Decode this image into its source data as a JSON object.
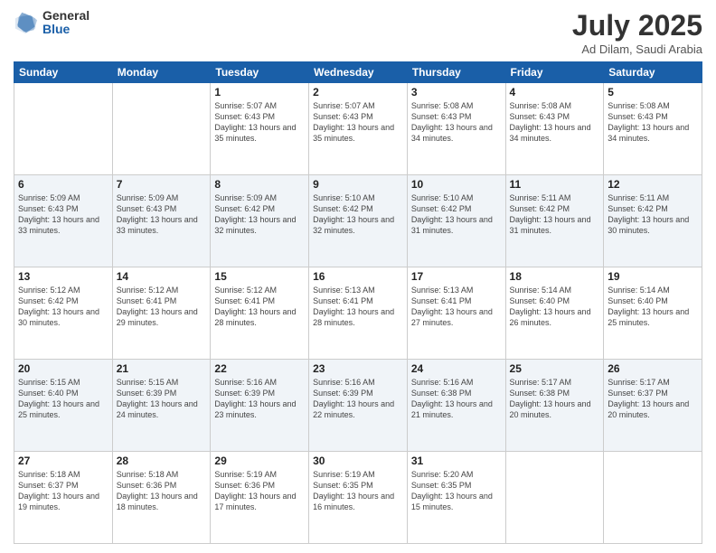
{
  "logo": {
    "general": "General",
    "blue": "Blue"
  },
  "header": {
    "title": "July 2025",
    "subtitle": "Ad Dilam, Saudi Arabia"
  },
  "weekdays": [
    "Sunday",
    "Monday",
    "Tuesday",
    "Wednesday",
    "Thursday",
    "Friday",
    "Saturday"
  ],
  "weeks": [
    [
      {
        "day": "",
        "info": ""
      },
      {
        "day": "",
        "info": ""
      },
      {
        "day": "1",
        "info": "Sunrise: 5:07 AM\nSunset: 6:43 PM\nDaylight: 13 hours and 35 minutes."
      },
      {
        "day": "2",
        "info": "Sunrise: 5:07 AM\nSunset: 6:43 PM\nDaylight: 13 hours and 35 minutes."
      },
      {
        "day": "3",
        "info": "Sunrise: 5:08 AM\nSunset: 6:43 PM\nDaylight: 13 hours and 34 minutes."
      },
      {
        "day": "4",
        "info": "Sunrise: 5:08 AM\nSunset: 6:43 PM\nDaylight: 13 hours and 34 minutes."
      },
      {
        "day": "5",
        "info": "Sunrise: 5:08 AM\nSunset: 6:43 PM\nDaylight: 13 hours and 34 minutes."
      }
    ],
    [
      {
        "day": "6",
        "info": "Sunrise: 5:09 AM\nSunset: 6:43 PM\nDaylight: 13 hours and 33 minutes."
      },
      {
        "day": "7",
        "info": "Sunrise: 5:09 AM\nSunset: 6:43 PM\nDaylight: 13 hours and 33 minutes."
      },
      {
        "day": "8",
        "info": "Sunrise: 5:09 AM\nSunset: 6:42 PM\nDaylight: 13 hours and 32 minutes."
      },
      {
        "day": "9",
        "info": "Sunrise: 5:10 AM\nSunset: 6:42 PM\nDaylight: 13 hours and 32 minutes."
      },
      {
        "day": "10",
        "info": "Sunrise: 5:10 AM\nSunset: 6:42 PM\nDaylight: 13 hours and 31 minutes."
      },
      {
        "day": "11",
        "info": "Sunrise: 5:11 AM\nSunset: 6:42 PM\nDaylight: 13 hours and 31 minutes."
      },
      {
        "day": "12",
        "info": "Sunrise: 5:11 AM\nSunset: 6:42 PM\nDaylight: 13 hours and 30 minutes."
      }
    ],
    [
      {
        "day": "13",
        "info": "Sunrise: 5:12 AM\nSunset: 6:42 PM\nDaylight: 13 hours and 30 minutes."
      },
      {
        "day": "14",
        "info": "Sunrise: 5:12 AM\nSunset: 6:41 PM\nDaylight: 13 hours and 29 minutes."
      },
      {
        "day": "15",
        "info": "Sunrise: 5:12 AM\nSunset: 6:41 PM\nDaylight: 13 hours and 28 minutes."
      },
      {
        "day": "16",
        "info": "Sunrise: 5:13 AM\nSunset: 6:41 PM\nDaylight: 13 hours and 28 minutes."
      },
      {
        "day": "17",
        "info": "Sunrise: 5:13 AM\nSunset: 6:41 PM\nDaylight: 13 hours and 27 minutes."
      },
      {
        "day": "18",
        "info": "Sunrise: 5:14 AM\nSunset: 6:40 PM\nDaylight: 13 hours and 26 minutes."
      },
      {
        "day": "19",
        "info": "Sunrise: 5:14 AM\nSunset: 6:40 PM\nDaylight: 13 hours and 25 minutes."
      }
    ],
    [
      {
        "day": "20",
        "info": "Sunrise: 5:15 AM\nSunset: 6:40 PM\nDaylight: 13 hours and 25 minutes."
      },
      {
        "day": "21",
        "info": "Sunrise: 5:15 AM\nSunset: 6:39 PM\nDaylight: 13 hours and 24 minutes."
      },
      {
        "day": "22",
        "info": "Sunrise: 5:16 AM\nSunset: 6:39 PM\nDaylight: 13 hours and 23 minutes."
      },
      {
        "day": "23",
        "info": "Sunrise: 5:16 AM\nSunset: 6:39 PM\nDaylight: 13 hours and 22 minutes."
      },
      {
        "day": "24",
        "info": "Sunrise: 5:16 AM\nSunset: 6:38 PM\nDaylight: 13 hours and 21 minutes."
      },
      {
        "day": "25",
        "info": "Sunrise: 5:17 AM\nSunset: 6:38 PM\nDaylight: 13 hours and 20 minutes."
      },
      {
        "day": "26",
        "info": "Sunrise: 5:17 AM\nSunset: 6:37 PM\nDaylight: 13 hours and 20 minutes."
      }
    ],
    [
      {
        "day": "27",
        "info": "Sunrise: 5:18 AM\nSunset: 6:37 PM\nDaylight: 13 hours and 19 minutes."
      },
      {
        "day": "28",
        "info": "Sunrise: 5:18 AM\nSunset: 6:36 PM\nDaylight: 13 hours and 18 minutes."
      },
      {
        "day": "29",
        "info": "Sunrise: 5:19 AM\nSunset: 6:36 PM\nDaylight: 13 hours and 17 minutes."
      },
      {
        "day": "30",
        "info": "Sunrise: 5:19 AM\nSunset: 6:35 PM\nDaylight: 13 hours and 16 minutes."
      },
      {
        "day": "31",
        "info": "Sunrise: 5:20 AM\nSunset: 6:35 PM\nDaylight: 13 hours and 15 minutes."
      },
      {
        "day": "",
        "info": ""
      },
      {
        "day": "",
        "info": ""
      }
    ]
  ]
}
